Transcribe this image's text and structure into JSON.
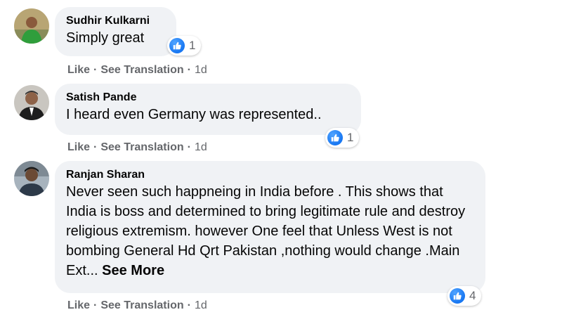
{
  "comments": [
    {
      "author": "Sudhir Kulkarni",
      "text": "Simply great",
      "reaction_count": "1",
      "like": "Like",
      "see_translation": "See Translation",
      "time": "1d"
    },
    {
      "author": "Satish Pande",
      "text": "I heard even Germany was represented..",
      "reaction_count": "1",
      "like": "Like",
      "see_translation": "See Translation",
      "time": "1d"
    },
    {
      "author": "Ranjan Sharan",
      "text": "Never seen such happneing in India before . This shows that India is boss and determined to bring legitimate rule and destroy religious extremism. however One feel that Unless West is not bombing General Hd Qrt Pakistan ,nothing would change .Main Ext...",
      "see_more": "See More",
      "reaction_count": "4",
      "like": "Like",
      "see_translation": "See Translation",
      "time": "1d"
    }
  ],
  "separator": "·",
  "colors": {
    "bubble": "#f0f2f5",
    "like_blue": "#1877f2",
    "meta_gray": "#65676b"
  },
  "icons": {
    "reaction": "thumbs-up-icon"
  }
}
